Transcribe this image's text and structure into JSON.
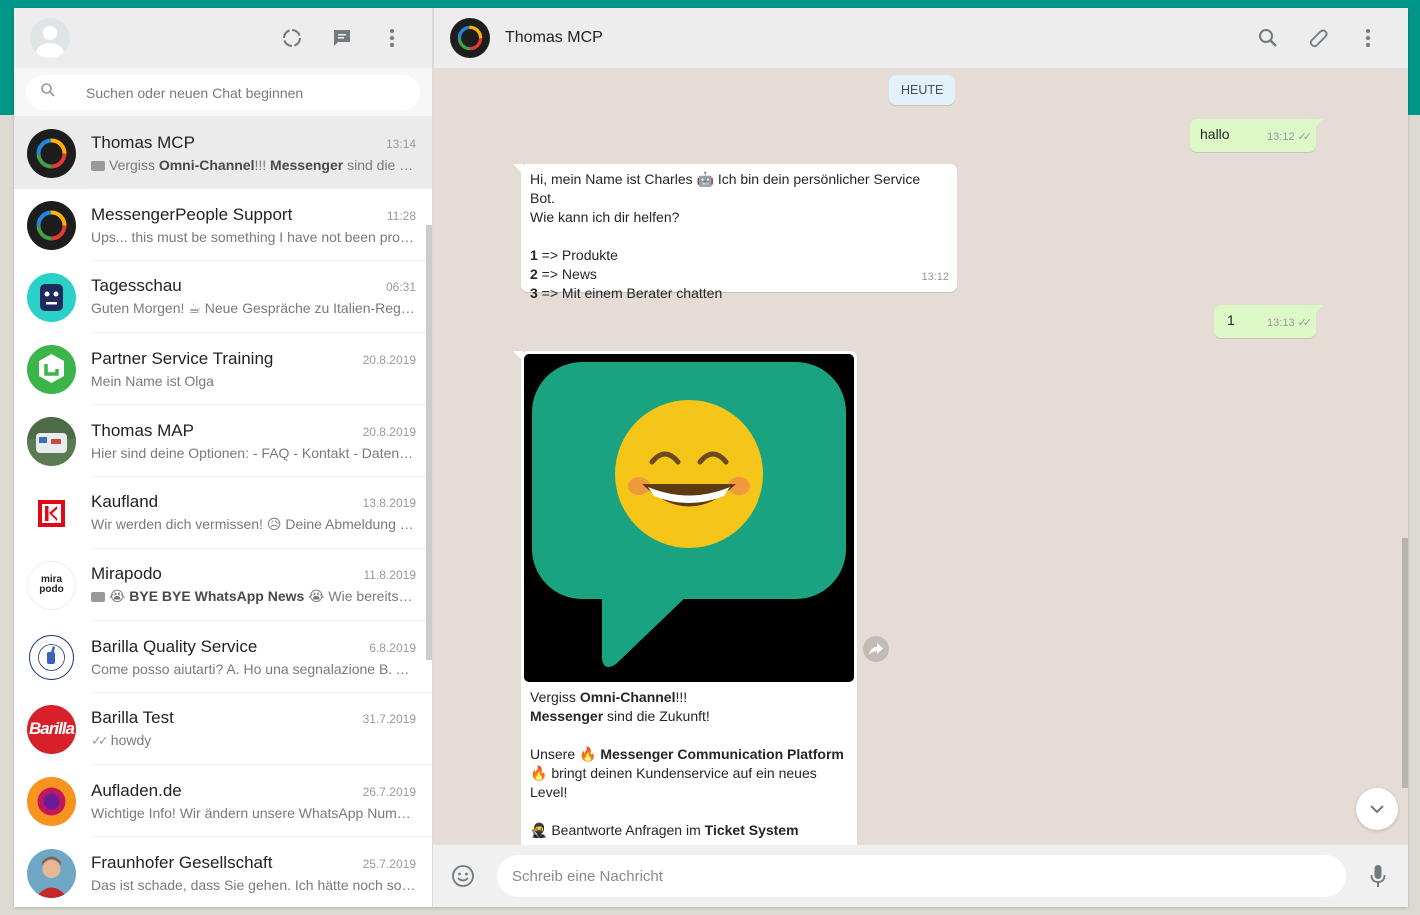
{
  "sidebar": {
    "search_placeholder": "Suchen oder neuen Chat beginnen",
    "chats": [
      {
        "name": "Thomas MCP",
        "time": "13:14",
        "pre": "Vergiss ",
        "b1": "Omni-Channel",
        "mid": "!!! ",
        "b2": "Messenger",
        "post": " sind die Zukunft!"
      },
      {
        "name": "MessengerPeople Support",
        "time": "11:28",
        "preview": "Ups... this must be something I have not been programmed for"
      },
      {
        "name": "Tagesschau",
        "time": "06:31",
        "preview_a": "Guten Morgen! ",
        "emoji": "☕",
        "preview_b": " Neue Gespräche zu Italien-Regierung"
      },
      {
        "name": "Partner Service Training",
        "time": "20.8.2019",
        "preview": "Mein Name ist Olga"
      },
      {
        "name": "Thomas MAP",
        "time": "20.8.2019",
        "preview": "Hier sind deine Optionen: - FAQ - Kontakt - Datenschutz"
      },
      {
        "name": "Kaufland",
        "time": "13.8.2019",
        "preview_a": "Wir werden dich vermissen! ",
        "emoji": "😥",
        "preview_b": " Deine Abmeldung wurde bestätigt"
      },
      {
        "name": "Mirapodo",
        "time": "11.8.2019",
        "emoji": "😭",
        "bold": " BYE BYE WhatsApp News ",
        "emoji2": "😭",
        "rest": " Wie bereits angekündigt"
      },
      {
        "name": "Barilla Quality Service",
        "time": "6.8.2019",
        "preview": "Come posso aiutarti? A. Ho una segnalazione B. Altro"
      },
      {
        "name": "Barilla Test",
        "time": "31.7.2019",
        "ticks": "✓✓",
        "preview": "howdy"
      },
      {
        "name": "Aufladen.de",
        "time": "26.7.2019",
        "preview": "Wichtige Info! Wir ändern unsere WhatsApp Nummer"
      },
      {
        "name": "Fraunhofer Gesellschaft",
        "time": "25.7.2019",
        "preview": "Das ist schade, dass Sie gehen. Ich hätte noch so viel zu erzählen"
      }
    ],
    "avatar_texts": {
      "mirapodo": "mira\npodo",
      "barilla": "Barilla",
      "seal": "QUALITY & FOOD SAFETY"
    }
  },
  "conversation": {
    "contact_name": "Thomas MCP",
    "day_chip": "HEUTE",
    "msg_hallo": {
      "text": "hallo",
      "time": "13:12"
    },
    "msg_bot": {
      "line1a": "Hi, mein Name ist Charles ",
      "robot": "🤖",
      "line1b": " Ich bin dein persönlicher Service Bot.",
      "line2": "Wie kann ich dir helfen?",
      "opt1_num": "1",
      "opt1": " => Produkte",
      "opt2_num": "2",
      "opt2": " => News",
      "opt3_num": "3",
      "opt3": " => Mit einem Berater chatten",
      "time": "13:12"
    },
    "msg_one": {
      "text": "1",
      "time": "13:13"
    },
    "msg_image": {
      "l1a": "Vergiss ",
      "l1b": "Omni-Channel",
      "l1c": "!!!",
      "l2a": "Messenger",
      "l2b": " sind die Zukunft!",
      "l3a": "Unsere ",
      "fire": "🔥",
      "l3b": " Messenger Communication Platform",
      "l4": " bringt deinen Kundenservice auf ein neues Level!",
      "ninja": "🥷",
      "l5a": " Beantworte Anfragen im ",
      "l5b": "Ticket System"
    },
    "composer_placeholder": "Schreib eine Nachricht"
  },
  "colors": {
    "accent": "#009688",
    "out_bubble": "#dcf8c6",
    "emoji_green": "#1aa380"
  }
}
